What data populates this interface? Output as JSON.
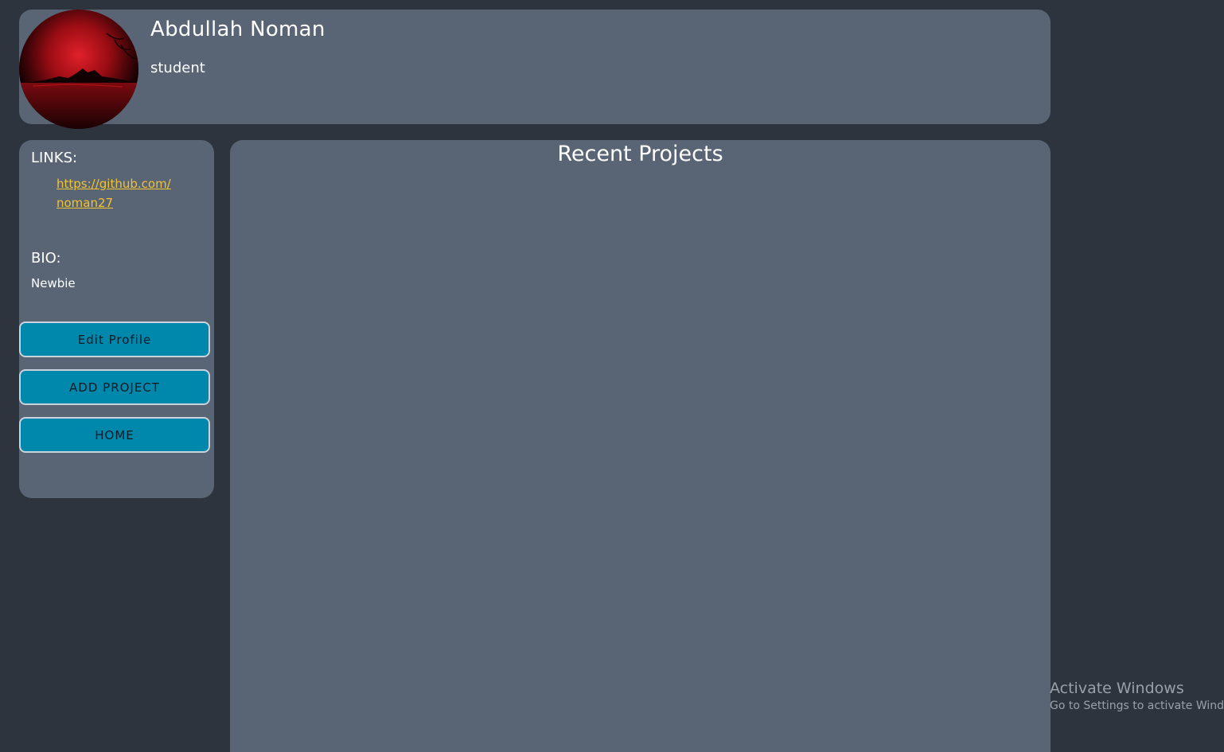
{
  "profile": {
    "name": "Abdullah Noman",
    "role": "student"
  },
  "sidebar": {
    "links_label": "LINKS:",
    "github_url": "https://github.com/noman27",
    "bio_label": "BIO:",
    "bio_text": "Newbie",
    "buttons": {
      "edit_profile": "Edit Profile",
      "add_project": "ADD PROJECT",
      "home": "HOME"
    }
  },
  "projects": {
    "title": "Recent Projects"
  },
  "watermark": {
    "title": "Activate Windows",
    "subtitle": "Go to Settings to activate Windows."
  },
  "colors": {
    "background": "#2e343e",
    "panel": "#596474",
    "button": "#0088ac",
    "link": "#f4c430"
  }
}
